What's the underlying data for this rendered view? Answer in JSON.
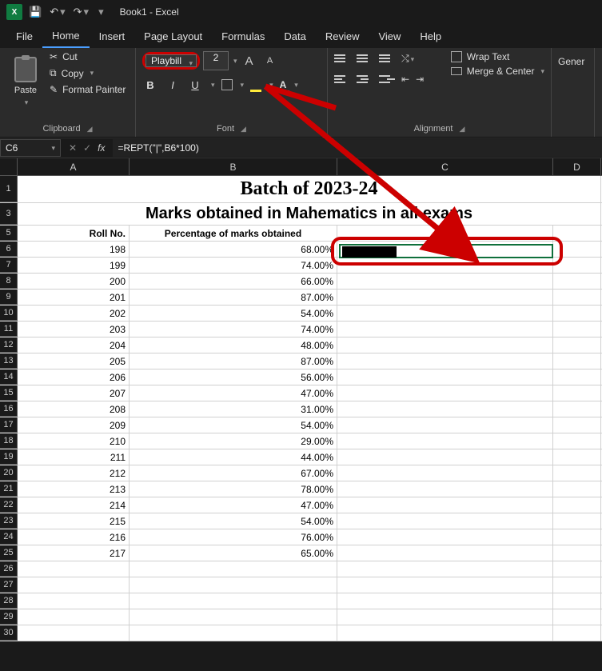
{
  "titlebar": {
    "app_icon_text": "X",
    "doc_title": "Book1 - Excel"
  },
  "menu": {
    "items": [
      "File",
      "Home",
      "Insert",
      "Page Layout",
      "Formulas",
      "Data",
      "Review",
      "View",
      "Help"
    ],
    "active_index": 1
  },
  "ribbon": {
    "clipboard": {
      "paste": "Paste",
      "cut": "Cut",
      "copy": "Copy",
      "format_painter": "Format Painter",
      "label": "Clipboard"
    },
    "font": {
      "name": "Playbill",
      "size": "2",
      "bold": "B",
      "italic": "I",
      "underline": "U",
      "grow": "A",
      "shrink": "A",
      "font_color_letter": "A",
      "label": "Font"
    },
    "alignment": {
      "wrap": "Wrap Text",
      "merge": "Merge & Center",
      "label": "Alignment"
    },
    "number": {
      "general": "Gener",
      "label": ""
    }
  },
  "formula_bar": {
    "name_box": "C6",
    "fx": "fx",
    "formula": "=REPT(\"|\",B6*100)"
  },
  "columns": [
    "A",
    "B",
    "C",
    "D"
  ],
  "sheet": {
    "title": "Batch of 2023-24",
    "subtitle": "Marks obtained in Mahematics in all exams",
    "headers": {
      "a": "Roll No.",
      "b": "Percentage of marks obtained"
    },
    "rows": [
      {
        "n": 6,
        "roll": "198",
        "pct": "68.00%"
      },
      {
        "n": 7,
        "roll": "199",
        "pct": "74.00%"
      },
      {
        "n": 8,
        "roll": "200",
        "pct": "66.00%"
      },
      {
        "n": 9,
        "roll": "201",
        "pct": "87.00%"
      },
      {
        "n": 10,
        "roll": "202",
        "pct": "54.00%"
      },
      {
        "n": 11,
        "roll": "203",
        "pct": "74.00%"
      },
      {
        "n": 12,
        "roll": "204",
        "pct": "48.00%"
      },
      {
        "n": 13,
        "roll": "205",
        "pct": "87.00%"
      },
      {
        "n": 14,
        "roll": "206",
        "pct": "56.00%"
      },
      {
        "n": 15,
        "roll": "207",
        "pct": "47.00%"
      },
      {
        "n": 16,
        "roll": "208",
        "pct": "31.00%"
      },
      {
        "n": 17,
        "roll": "209",
        "pct": "54.00%"
      },
      {
        "n": 18,
        "roll": "210",
        "pct": "29.00%"
      },
      {
        "n": 19,
        "roll": "211",
        "pct": "44.00%"
      },
      {
        "n": 20,
        "roll": "212",
        "pct": "67.00%"
      },
      {
        "n": 21,
        "roll": "213",
        "pct": "78.00%"
      },
      {
        "n": 22,
        "roll": "214",
        "pct": "47.00%"
      },
      {
        "n": 23,
        "roll": "215",
        "pct": "54.00%"
      },
      {
        "n": 24,
        "roll": "216",
        "pct": "76.00%"
      },
      {
        "n": 25,
        "roll": "217",
        "pct": "65.00%"
      }
    ],
    "empty_rows": [
      26,
      27,
      28,
      29,
      30
    ]
  },
  "chart_data": {
    "type": "table",
    "title": "Batch of 2023-24",
    "subtitle": "Marks obtained in Mahematics in all exams",
    "columns": [
      "Roll No.",
      "Percentage of marks obtained"
    ],
    "rows": [
      [
        198,
        0.68
      ],
      [
        199,
        0.74
      ],
      [
        200,
        0.66
      ],
      [
        201,
        0.87
      ],
      [
        202,
        0.54
      ],
      [
        203,
        0.74
      ],
      [
        204,
        0.48
      ],
      [
        205,
        0.87
      ],
      [
        206,
        0.56
      ],
      [
        207,
        0.47
      ],
      [
        208,
        0.31
      ],
      [
        209,
        0.54
      ],
      [
        210,
        0.29
      ],
      [
        211,
        0.44
      ],
      [
        212,
        0.67
      ],
      [
        213,
        0.78
      ],
      [
        214,
        0.47
      ],
      [
        215,
        0.54
      ],
      [
        216,
        0.76
      ],
      [
        217,
        0.65
      ]
    ]
  }
}
